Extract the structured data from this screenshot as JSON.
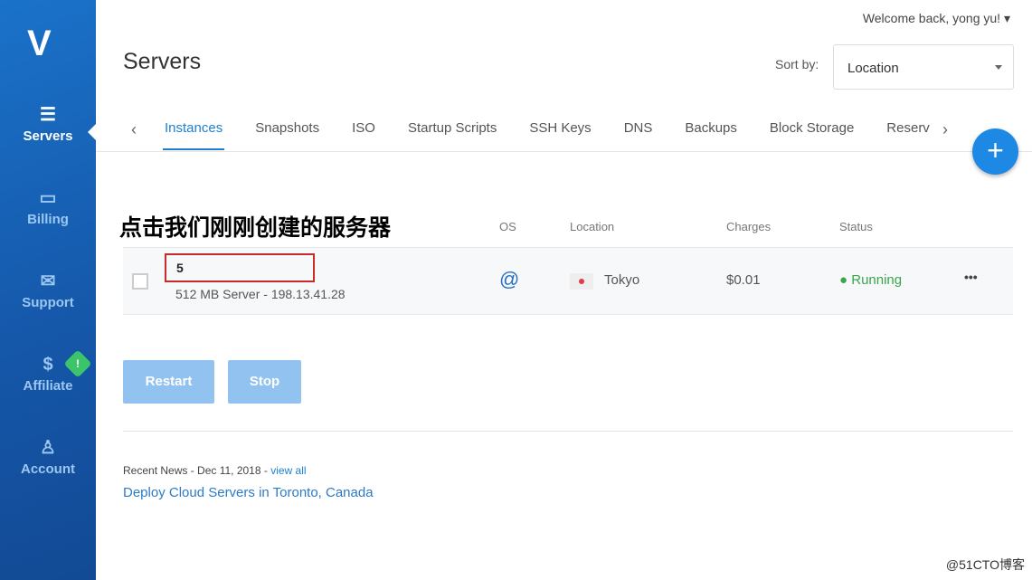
{
  "sidebar": {
    "logo": "V",
    "items": [
      {
        "label": "Servers",
        "icon": "servers-icon"
      },
      {
        "label": "Billing",
        "icon": "credit-card-icon"
      },
      {
        "label": "Support",
        "icon": "envelope-icon"
      },
      {
        "label": "Affiliate",
        "icon": "dollar-icon"
      },
      {
        "label": "Account",
        "icon": "user-icon"
      }
    ],
    "badge": "!"
  },
  "header": {
    "welcome": "Welcome back, yong yu!",
    "title": "Servers",
    "sort_label": "Sort by:",
    "sort_value": "Location"
  },
  "tabs": [
    "Instances",
    "Snapshots",
    "ISO",
    "Startup Scripts",
    "SSH Keys",
    "DNS",
    "Backups",
    "Block Storage",
    "Reserv"
  ],
  "annotation": "点击我们刚刚创建的服务器",
  "table": {
    "headers": {
      "os": "OS",
      "location": "Location",
      "charges": "Charges",
      "status": "Status"
    },
    "row": {
      "name": "5",
      "subtitle": "512 MB Server - 198.13.41.28",
      "location": "Tokyo",
      "charges": "$0.01",
      "status": "Running",
      "more": "•••"
    }
  },
  "buttons": {
    "restart": "Restart",
    "stop": "Stop"
  },
  "news": {
    "prefix": "Recent News - Dec 11, 2018 - ",
    "link": "view all",
    "headline": "Deploy Cloud Servers in Toronto, Canada"
  },
  "watermark": "@51CTO博客",
  "colors": {
    "accent": "#1e7fd1",
    "running": "#3aa54a",
    "highlight": "#c92a2a"
  }
}
